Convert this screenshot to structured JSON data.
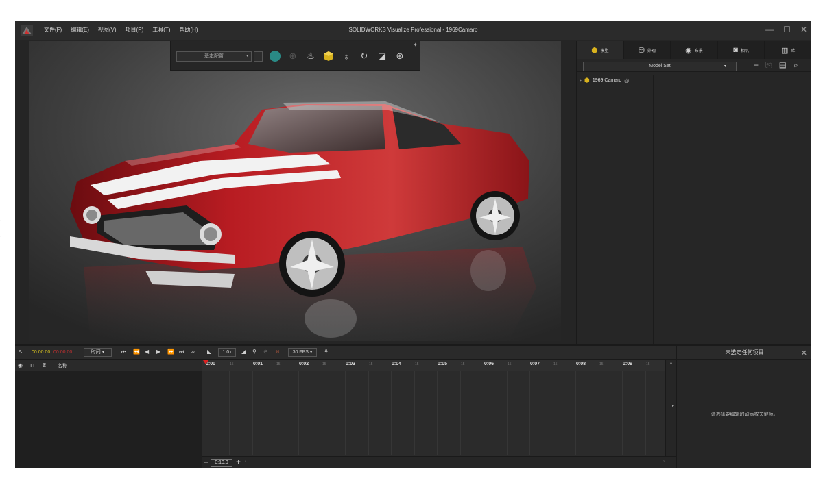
{
  "window": {
    "title": "SOLIDWORKS Visualize Professional - 1969Camaro",
    "controls": [
      "—",
      "☐",
      "✕"
    ]
  },
  "menu": [
    "文件(F)",
    "编辑(E)",
    "视图(V)",
    "项目(P)",
    "工具(T)",
    "帮助(H)"
  ],
  "viewport_toolbar": {
    "config_label": "基本配置"
  },
  "right_panel": {
    "tabs": [
      "模型",
      "外观",
      "布景",
      "相机",
      "库"
    ],
    "model_set": "Model Set",
    "tree_item": "1969 Camaro"
  },
  "timeline": {
    "time_current": "00:00:00",
    "time_total": "00:00:00",
    "mode_label": "时间",
    "speed_label": "1.0x",
    "fps_label": "30 FPS",
    "name_header": "名称",
    "duration": "0:10.0",
    "ruler_ticks": [
      "0:00",
      "0:01",
      "0:02",
      "0:03",
      "0:04",
      "0:05",
      "0:06",
      "0:07",
      "0:08",
      "0:09"
    ],
    "minor_tick": "15"
  },
  "props_panel": {
    "title": "未选定任何项目",
    "hint": "请选择要编辑的动画或关键帧。"
  },
  "colors": {
    "accent_gold": "#d8b21e",
    "playhead_red": "#dd2222",
    "car_red": "#b81c22"
  }
}
